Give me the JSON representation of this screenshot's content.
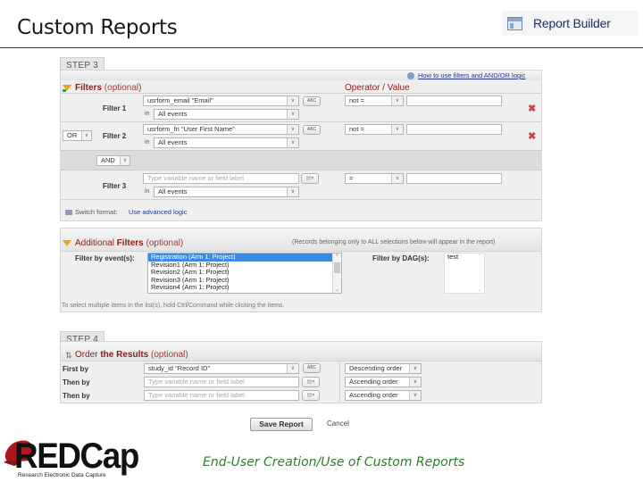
{
  "slide": {
    "title": "Custom Reports",
    "footer_caption": "End-User Creation/Use of Custom Reports"
  },
  "header_badge": {
    "icon": "report-builder-icon",
    "label": "Report Builder"
  },
  "step3": {
    "tab_label": "STEP 3",
    "section_title_bold": "Filters",
    "section_title_optional": "(optional)",
    "help_link": "How to use filters and AND/OR logic",
    "operator_header": "Operator / Value",
    "filters": [
      {
        "label": "Filter 1",
        "logic": null,
        "field": "usrform_email \"Email\"",
        "in_label": "in",
        "event": "All events",
        "operator": "not =",
        "value": "",
        "abc_label": "ABC"
      },
      {
        "label": "Filter 2",
        "logic": "OR",
        "field": "usrform_fn \"User First Name\"",
        "in_label": "in",
        "event": "All events",
        "operator": "not =",
        "value": "",
        "abc_label": "ABC"
      },
      {
        "label": "Filter 3",
        "logic": null,
        "field_placeholder": "Type variable name or field label",
        "in_label": "in",
        "event": "All events",
        "operator": "=",
        "value": ""
      }
    ],
    "group_logic": "AND",
    "switch_format_label": "Switch format:",
    "advanced_logic_link": "Use advanced logic"
  },
  "additional_filters": {
    "title_prefix": "Additional",
    "title_bold": "Filters",
    "title_optional": "(optional)",
    "note": "(Records belonging only to ALL selections below will appear in the report)",
    "events_label": "Filter by event(s):",
    "events": [
      {
        "label": "Registration (Arm 1: Project)",
        "selected": true
      },
      {
        "label": "Revision1 (Arm 1: Project)",
        "selected": false
      },
      {
        "label": "Revision2 (Arm 1: Project)",
        "selected": false
      },
      {
        "label": "Revision3 (Arm 1: Project)",
        "selected": false
      },
      {
        "label": "Revision4 (Arm 1: Project)",
        "selected": false
      }
    ],
    "dag_label": "Filter by DAG(s):",
    "dags": [
      "test"
    ],
    "hint": "To select multiple items in the list(s), hold Ctrl/Command while clicking the items."
  },
  "step4": {
    "tab_label": "STEP 4",
    "section_title_prefix": "Order",
    "section_title_bold": "the Results",
    "section_title_optional": "(optional)",
    "rows": [
      {
        "label": "First by",
        "field": "study_id \"Record ID\"",
        "order": "Descending order",
        "abc_label": "ABC"
      },
      {
        "label": "Then by",
        "field_placeholder": "Type variable name or field label",
        "order": "Ascending order"
      },
      {
        "label": "Then by",
        "field_placeholder": "Type variable name or field label",
        "order": "Ascending order"
      }
    ]
  },
  "actions": {
    "save_label": "Save Report",
    "cancel_label": "Cancel"
  },
  "logo": {
    "wordmark": "REDCap",
    "tagline": "Research Electronic Data Capture",
    "brand_color": "#b0161e"
  },
  "colors": {
    "section_title": "#8b1a1a",
    "link": "#2a3a8a",
    "selected_item": "#3b8be3",
    "delete_icon": "#cc4444",
    "footer_caption": "#2e7d2e"
  }
}
